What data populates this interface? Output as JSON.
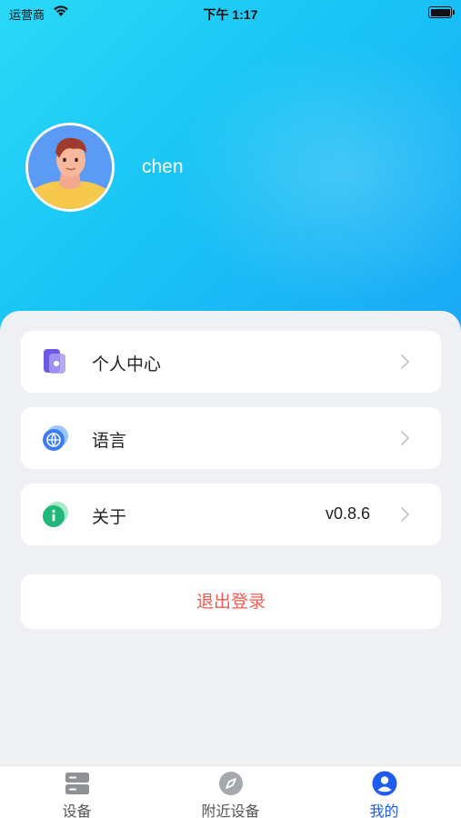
{
  "status_bar": {
    "carrier": "运营商",
    "time": "下午 1:17"
  },
  "profile": {
    "username": "chen"
  },
  "menu": [
    {
      "label": "个人中心",
      "value": "",
      "icon": "user-center-icon"
    },
    {
      "label": "语言",
      "value": "",
      "icon": "globe-icon"
    },
    {
      "label": "关于",
      "value": "v0.8.6",
      "icon": "info-icon"
    }
  ],
  "logout_label": "退出登录",
  "tabbar": [
    {
      "label": "设备",
      "icon": "device-list-icon",
      "active": false
    },
    {
      "label": "附近设备",
      "icon": "compass-icon",
      "active": false
    },
    {
      "label": "我的",
      "icon": "person-icon",
      "active": true
    }
  ],
  "colors": {
    "accent": "#1e5bf0",
    "logout": "#f25c54",
    "hero_start": "#2ad9f7",
    "hero_end": "#1aa8f7"
  }
}
